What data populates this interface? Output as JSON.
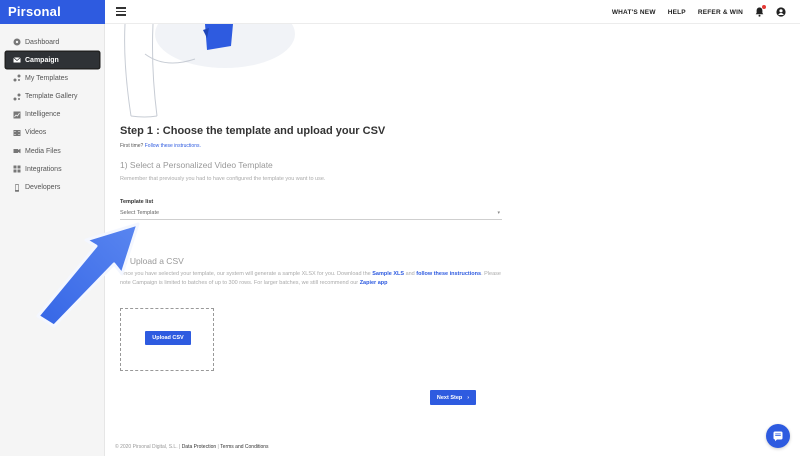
{
  "brand": {
    "name": "Pirsonal",
    "color": "#2e5be0"
  },
  "topbar": {
    "links": [
      "WHAT'S NEW",
      "HELP",
      "REFER & WIN"
    ],
    "icons": [
      "menu-icon",
      "bell-icon",
      "account-icon"
    ]
  },
  "sidebar": {
    "items": [
      {
        "label": "Dashboard",
        "icon": "dashboard-icon",
        "active": false
      },
      {
        "label": "Campaign",
        "icon": "mail-icon",
        "active": true
      },
      {
        "label": "My Templates",
        "icon": "templates-icon",
        "active": false
      },
      {
        "label": "Template Gallery",
        "icon": "gallery-icon",
        "active": false
      },
      {
        "label": "Intelligence",
        "icon": "chart-icon",
        "active": false
      },
      {
        "label": "Videos",
        "icon": "video-icon",
        "active": false
      },
      {
        "label": "Media Files",
        "icon": "media-icon",
        "active": false
      },
      {
        "label": "Integrations",
        "icon": "grid-icon",
        "active": false
      },
      {
        "label": "Developers",
        "icon": "phone-icon",
        "active": false
      }
    ]
  },
  "main": {
    "step_title": "Step 1 : Choose the template and upload your CSV",
    "first_time_prefix": "First time?",
    "first_time_link": "Follow these instructions.",
    "section1": {
      "title": "1) Select a Personalized Video Template",
      "subtitle": "Remember that previously you had to have configured the template you want to use.",
      "field_label": "Template list",
      "select_value": "Select Template"
    },
    "section2": {
      "title": "2) Upload a CSV",
      "text_1": "Once you have selected your template, our system will generate a sample XLSX for you. Download the",
      "link_sample": "Sample XLS",
      "text_2": "and",
      "link_instructions": "follow these instructions",
      "text_3": ". Please note Campaign is limited to batches of up to 300 rows. For larger batches, we still recommend our",
      "link_zapier": "Zapier app",
      "upload_button": "Upload CSV"
    },
    "next_button": "Next Step"
  },
  "footer": {
    "copyright": "© 2020 Pirsonal Digital, S.L. |",
    "link_data": "Data Protection",
    "separator": "|",
    "link_terms": "Terms and Conditions"
  },
  "colors": {
    "accent": "#2e5be0",
    "sidebar_active": "#2f3236",
    "arrow": "#3a6be8"
  }
}
